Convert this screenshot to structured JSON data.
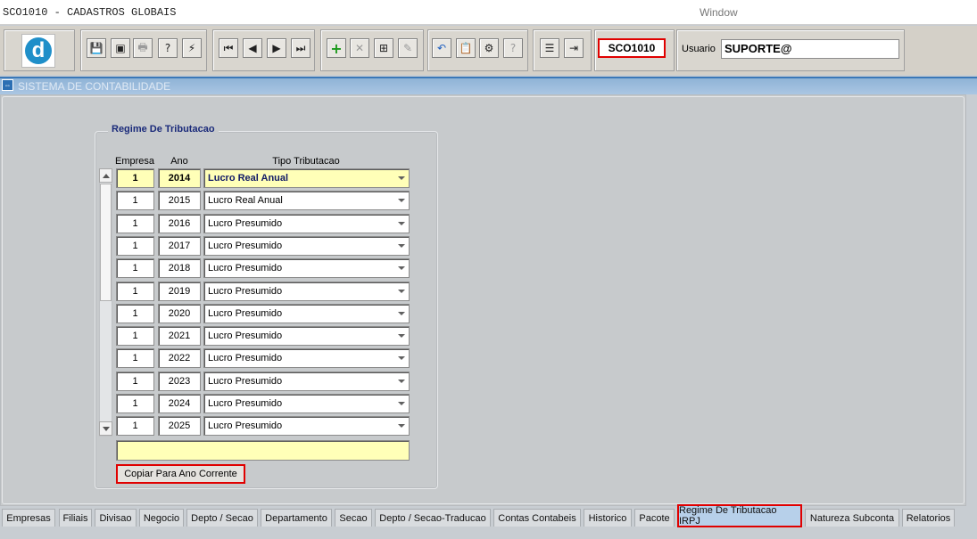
{
  "window": {
    "title": "SCO1010 - CADASTROS GLOBAIS",
    "menu_window": "Window"
  },
  "toolbar": {
    "logo_letter": "d",
    "form_code": "SCO1010",
    "user_label": "Usuario",
    "user_value": "SUPORTE@",
    "buttons": [
      {
        "name": "save-icon",
        "glyph": "💾"
      },
      {
        "name": "window-icon",
        "glyph": "▣"
      },
      {
        "name": "print-icon",
        "glyph": "🖶"
      },
      {
        "name": "help-query-icon",
        "glyph": "?"
      },
      {
        "name": "execute-query-icon",
        "glyph": "⚡"
      },
      {
        "name": "first-record-icon",
        "glyph": "⏮"
      },
      {
        "name": "previous-record-icon",
        "glyph": "◀"
      },
      {
        "name": "next-record-icon",
        "glyph": "▶"
      },
      {
        "name": "last-record-icon",
        "glyph": "⏭"
      },
      {
        "name": "insert-record-icon",
        "glyph": "+"
      },
      {
        "name": "delete-record-icon",
        "glyph": "✕"
      },
      {
        "name": "duplicate-record-icon",
        "glyph": "⊞"
      },
      {
        "name": "edit-icon",
        "glyph": "✎"
      },
      {
        "name": "undo-icon",
        "glyph": "↶"
      },
      {
        "name": "clipboard-icon",
        "glyph": "📋"
      },
      {
        "name": "tools-icon",
        "glyph": "⚙"
      },
      {
        "name": "help-icon",
        "glyph": "?"
      },
      {
        "name": "menu-icon",
        "glyph": "☰"
      },
      {
        "name": "exit-icon",
        "glyph": "⇥"
      }
    ]
  },
  "module": {
    "title": "SISTEMA DE CONTABILIDADE"
  },
  "frame": {
    "title": "Regime De Tributacao",
    "headers": {
      "empresa": "Empresa",
      "ano": "Ano",
      "tipo": "Tipo Tributacao"
    },
    "rows": [
      {
        "empresa": "1",
        "ano": "2014",
        "tipo": "Lucro Real Anual"
      },
      {
        "empresa": "1",
        "ano": "2015",
        "tipo": "Lucro Real Anual"
      },
      {
        "empresa": "1",
        "ano": "2016",
        "tipo": "Lucro Presumido"
      },
      {
        "empresa": "1",
        "ano": "2017",
        "tipo": "Lucro Presumido"
      },
      {
        "empresa": "1",
        "ano": "2018",
        "tipo": "Lucro Presumido"
      },
      {
        "empresa": "1",
        "ano": "2019",
        "tipo": "Lucro Presumido"
      },
      {
        "empresa": "1",
        "ano": "2020",
        "tipo": "Lucro Presumido"
      },
      {
        "empresa": "1",
        "ano": "2021",
        "tipo": "Lucro Presumido"
      },
      {
        "empresa": "1",
        "ano": "2022",
        "tipo": "Lucro Presumido"
      },
      {
        "empresa": "1",
        "ano": "2023",
        "tipo": "Lucro Presumido"
      },
      {
        "empresa": "1",
        "ano": "2024",
        "tipo": "Lucro Presumido"
      },
      {
        "empresa": "1",
        "ano": "2025",
        "tipo": "Lucro Presumido"
      }
    ],
    "copy_button": "Copiar Para Ano Corrente"
  },
  "tabs": [
    {
      "label": "Empresas"
    },
    {
      "label": "Filiais"
    },
    {
      "label": "Divisao"
    },
    {
      "label": "Negocio"
    },
    {
      "label": "Depto / Secao"
    },
    {
      "label": "Departamento"
    },
    {
      "label": "Secao"
    },
    {
      "label": "Depto / Secao-Traducao"
    },
    {
      "label": "Contas Contabeis"
    },
    {
      "label": "Historico"
    },
    {
      "label": "Pacote"
    },
    {
      "label": "Regime De Tributacao IRPJ",
      "active": true
    },
    {
      "label": "Natureza Subconta"
    },
    {
      "label": "Relatorios"
    }
  ]
}
